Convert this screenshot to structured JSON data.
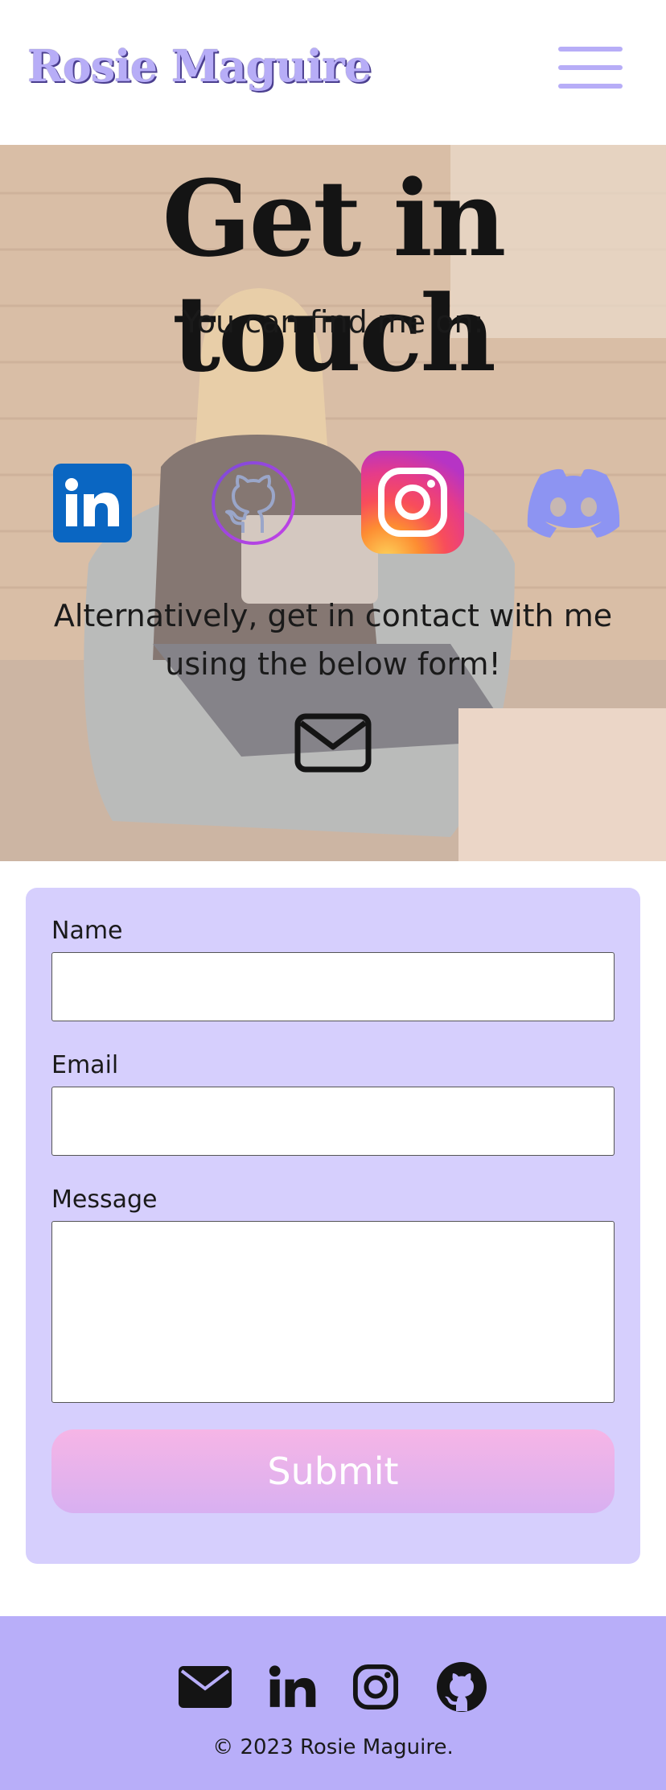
{
  "header": {
    "brand": "Rosie Maguire",
    "menu_icon": "hamburger-menu-icon"
  },
  "hero": {
    "title": "Get in touch",
    "subtitle": "You can find me on:",
    "social_icons": [
      "linkedin-icon",
      "github-icon",
      "instagram-icon",
      "discord-icon"
    ],
    "alternative_text": "Alternatively, get in contact with me using the below form!",
    "mail_icon": "envelope-icon"
  },
  "form": {
    "name_label": "Name",
    "name_value": "",
    "email_label": "Email",
    "email_value": "",
    "message_label": "Message",
    "message_value": "",
    "submit_label": "Submit"
  },
  "footer": {
    "icons": [
      "envelope-icon",
      "linkedin-icon",
      "instagram-icon",
      "github-icon"
    ],
    "copyright": "© 2023 Rosie Maguire."
  },
  "colors": {
    "brand": "#b7adf7",
    "form_bg": "#d6cffd",
    "footer_bg": "#b8aef9",
    "submit_gradient_start": "#f6b5e6",
    "submit_gradient_end": "#d8b0f1"
  }
}
